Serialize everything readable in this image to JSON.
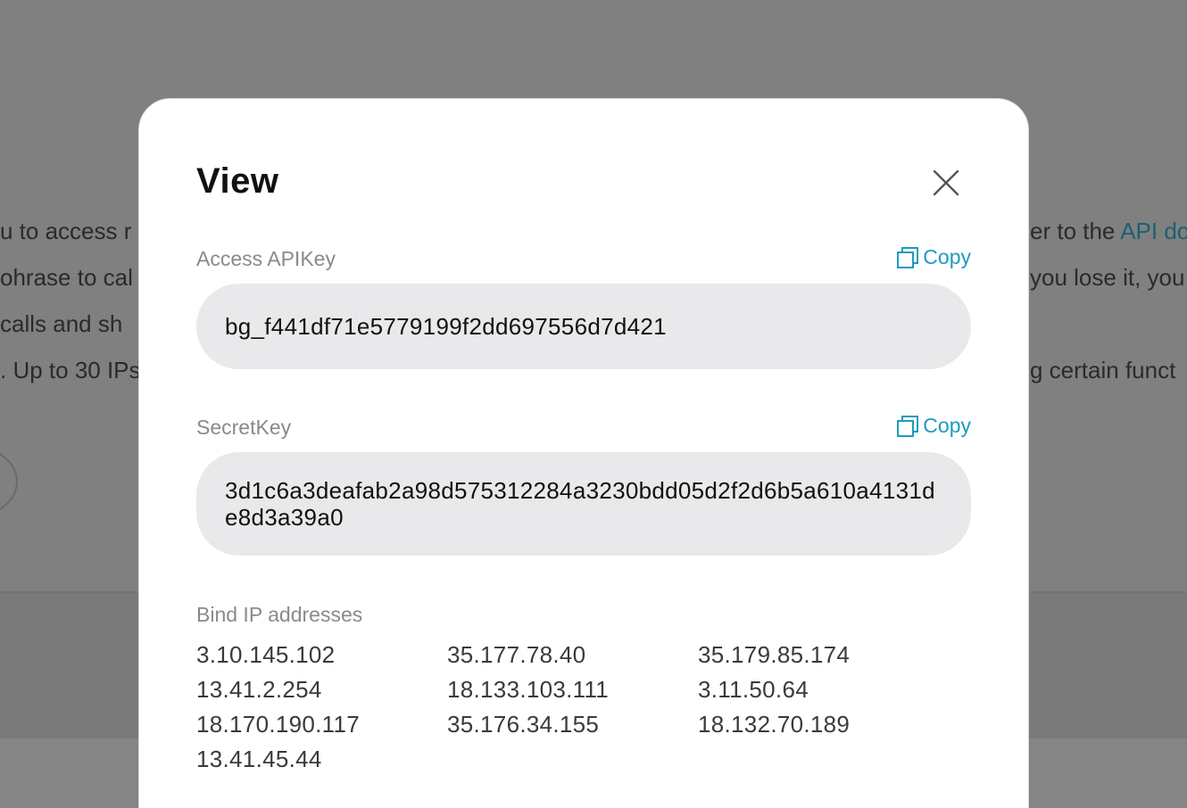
{
  "background": {
    "lines_left": [
      "u to access r",
      "ohrase to cal",
      " calls and sh",
      ". Up to 30 IPs"
    ],
    "lines_right_prefix": "er to the ",
    "lines_right_link": "API do",
    "lines_right": [
      "you lose it, you",
      "",
      "g certain funct"
    ]
  },
  "modal": {
    "title": "View",
    "api_key": {
      "label": "Access APIKey",
      "copy_label": "Copy",
      "value": "bg_f441df71e5779199f2dd697556d7d421"
    },
    "secret_key": {
      "label": "SecretKey",
      "copy_label": "Copy",
      "value": "3d1c6a3deafab2a98d575312284a3230bdd05d2f2d6b5a610a4131de8d3a39a0"
    },
    "bind_ip": {
      "label": "Bind IP addresses",
      "ips": [
        "3.10.145.102",
        "35.177.78.40",
        "35.179.85.174",
        "13.41.2.254",
        "18.133.103.111",
        "3.11.50.64",
        "18.170.190.117",
        "35.176.34.155",
        "18.132.70.189",
        "13.41.45.44"
      ]
    }
  },
  "colors": {
    "overlay": "#808080",
    "accent": "#1f9bbd",
    "field_bg": "#e9e9eb"
  },
  "icons": {
    "close": "close-icon",
    "copy": "copy-icon"
  }
}
